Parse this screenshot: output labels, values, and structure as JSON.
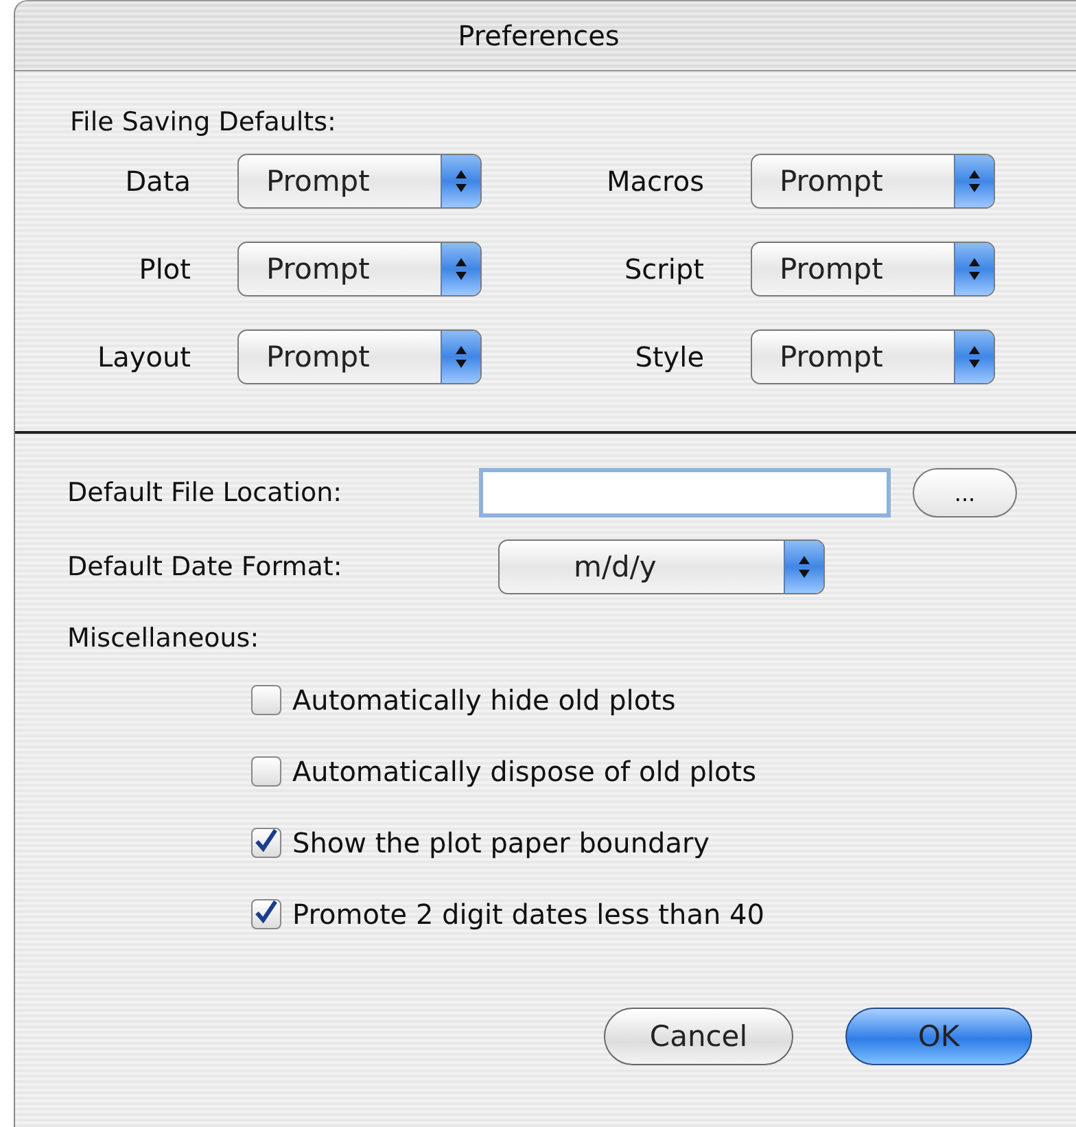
{
  "window": {
    "title": "Preferences"
  },
  "file_saving": {
    "heading": "File Saving Defaults:",
    "items": [
      {
        "label": "Data",
        "value": "Prompt"
      },
      {
        "label": "Macros",
        "value": "Prompt"
      },
      {
        "label": "Plot",
        "value": "Prompt"
      },
      {
        "label": "Script",
        "value": "Prompt"
      },
      {
        "label": "Layout",
        "value": "Prompt"
      },
      {
        "label": "Style",
        "value": "Prompt"
      }
    ]
  },
  "file_location": {
    "label": "Default File Location:",
    "focused": true,
    "browse": "..."
  },
  "date_format": {
    "label": "Default Date Format:",
    "value": "m/d/y"
  },
  "misc": {
    "heading": "Miscellaneous:",
    "options": [
      {
        "label": "Automatically hide old plots",
        "checked": false
      },
      {
        "label": "Automatically dispose of old plots",
        "checked": false
      },
      {
        "label": "Show the plot paper boundary",
        "checked": true
      },
      {
        "label": "Promote 2 digit dates less than 40",
        "checked": true
      }
    ]
  },
  "buttons": [
    {
      "label": "Cancel",
      "default": false
    },
    {
      "label": "OK",
      "default": true
    }
  ]
}
